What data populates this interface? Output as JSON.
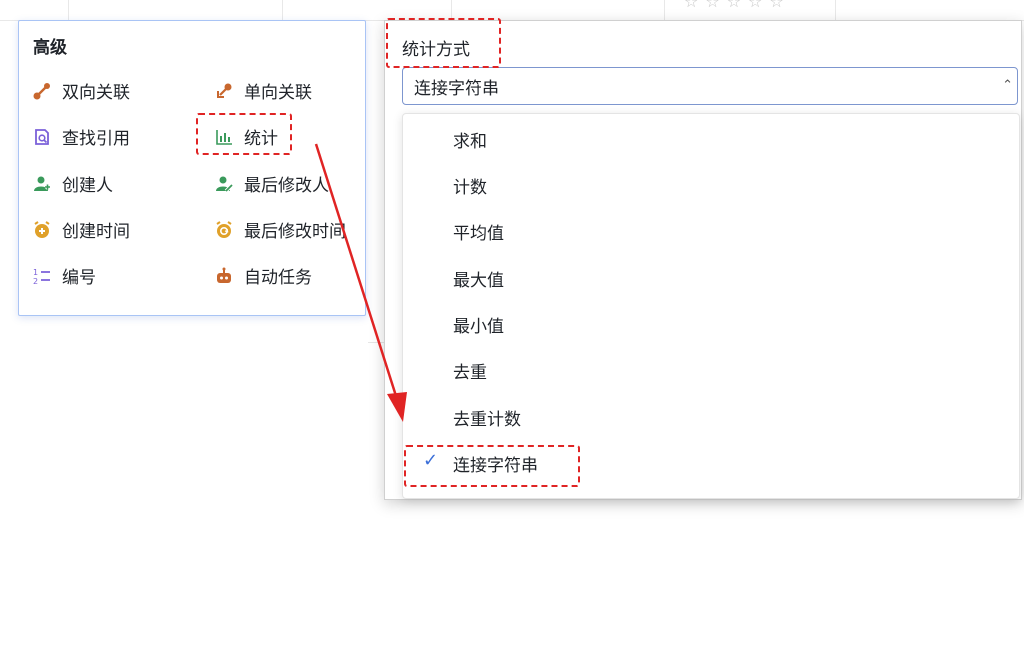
{
  "advanced_panel": {
    "title": "高级",
    "items": [
      {
        "label": "双向关联",
        "icon": "link-bidirectional-icon"
      },
      {
        "label": "单向关联",
        "icon": "link-unidirectional-icon"
      },
      {
        "label": "查找引用",
        "icon": "lookup-icon"
      },
      {
        "label": "统计",
        "icon": "bar-chart-icon"
      },
      {
        "label": "创建人",
        "icon": "user-add-icon"
      },
      {
        "label": "最后修改人",
        "icon": "user-edit-icon"
      },
      {
        "label": "创建时间",
        "icon": "alarm-add-icon"
      },
      {
        "label": "最后修改时间",
        "icon": "alarm-refresh-icon"
      },
      {
        "label": "编号",
        "icon": "numbering-icon"
      },
      {
        "label": "自动任务",
        "icon": "robot-icon"
      }
    ]
  },
  "config_panel": {
    "label": "统计方式",
    "selected": "连接字符串",
    "options": [
      "求和",
      "计数",
      "平均值",
      "最大值",
      "最小值",
      "去重",
      "去重计数",
      "连接字符串"
    ]
  },
  "colors": {
    "accent": "#3b6fd8",
    "highlight": "#e02424",
    "icon_orange": "#c8672e",
    "icon_purple": "#7b61d9",
    "icon_green": "#3a9a5b",
    "icon_gold": "#e0a12a"
  }
}
